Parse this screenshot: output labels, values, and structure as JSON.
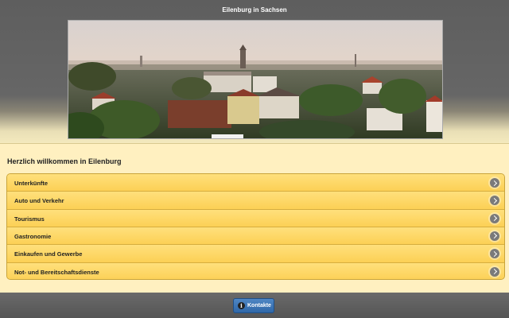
{
  "header": {
    "title": "Eilenburg in Sachsen"
  },
  "main": {
    "welcome": "Herzlich willkommen in Eilenburg",
    "menu": [
      {
        "label": "Unterkünfte"
      },
      {
        "label": "Auto und Verkehr"
      },
      {
        "label": "Tourismus"
      },
      {
        "label": "Gastronomie"
      },
      {
        "label": "Einkaufen und Gewerbe"
      },
      {
        "label": "Not- und Bereitschaftsdienste"
      }
    ]
  },
  "footer": {
    "contacts_label": "Kontakte",
    "contacts_icon": "info-icon"
  },
  "colors": {
    "menu_background": "#fcd055",
    "menu_border": "#c9a43a",
    "button_blue": "#2f67a8",
    "content_background": "#fff0c0"
  }
}
